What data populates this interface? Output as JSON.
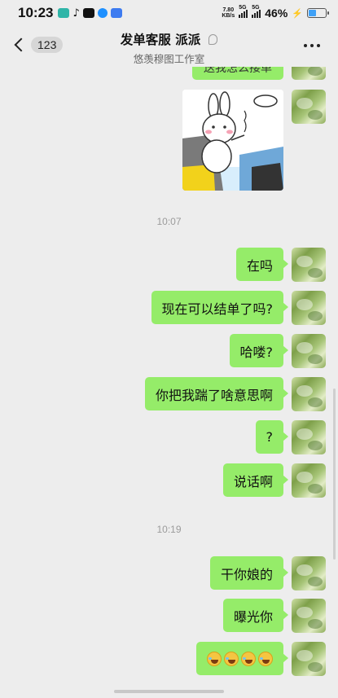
{
  "status_bar": {
    "time": "10:23",
    "app_icons": [
      "app-icon",
      "tiktok-icon",
      "tv-icon",
      "youku-icon",
      "cloud-icon",
      "shield-icon"
    ],
    "net_speed_value": "7.80",
    "net_speed_unit": "KB/s",
    "signal_1_label": "5G",
    "signal_2_label": "5G",
    "battery_pct": "46%",
    "battery_level": 0.46,
    "charging": true
  },
  "header": {
    "unread_count": "123",
    "title": "发单客服 派派",
    "subtitle": "悠羡穆图工作室"
  },
  "messages": {
    "partial_bubble_text": "送我怎么接单",
    "sticker_icon": "bunny-sticker",
    "timestamp_1": "10:07",
    "m1": "在吗",
    "m2": "现在可以结单了吗?",
    "m3": "哈喽?",
    "m4": "你把我踹了啥意思啊",
    "m5": "?",
    "m6": "说话啊",
    "timestamp_2": "10:19",
    "m7": "干你娘的",
    "m8": "曝光你",
    "m9_emojis": [
      "sweat-smile-emoji",
      "sweat-smile-emoji",
      "sweat-smile-emoji",
      "sweat-smile-emoji"
    ]
  },
  "colors": {
    "bubble_green": "#95ec69",
    "background": "#ededed"
  }
}
